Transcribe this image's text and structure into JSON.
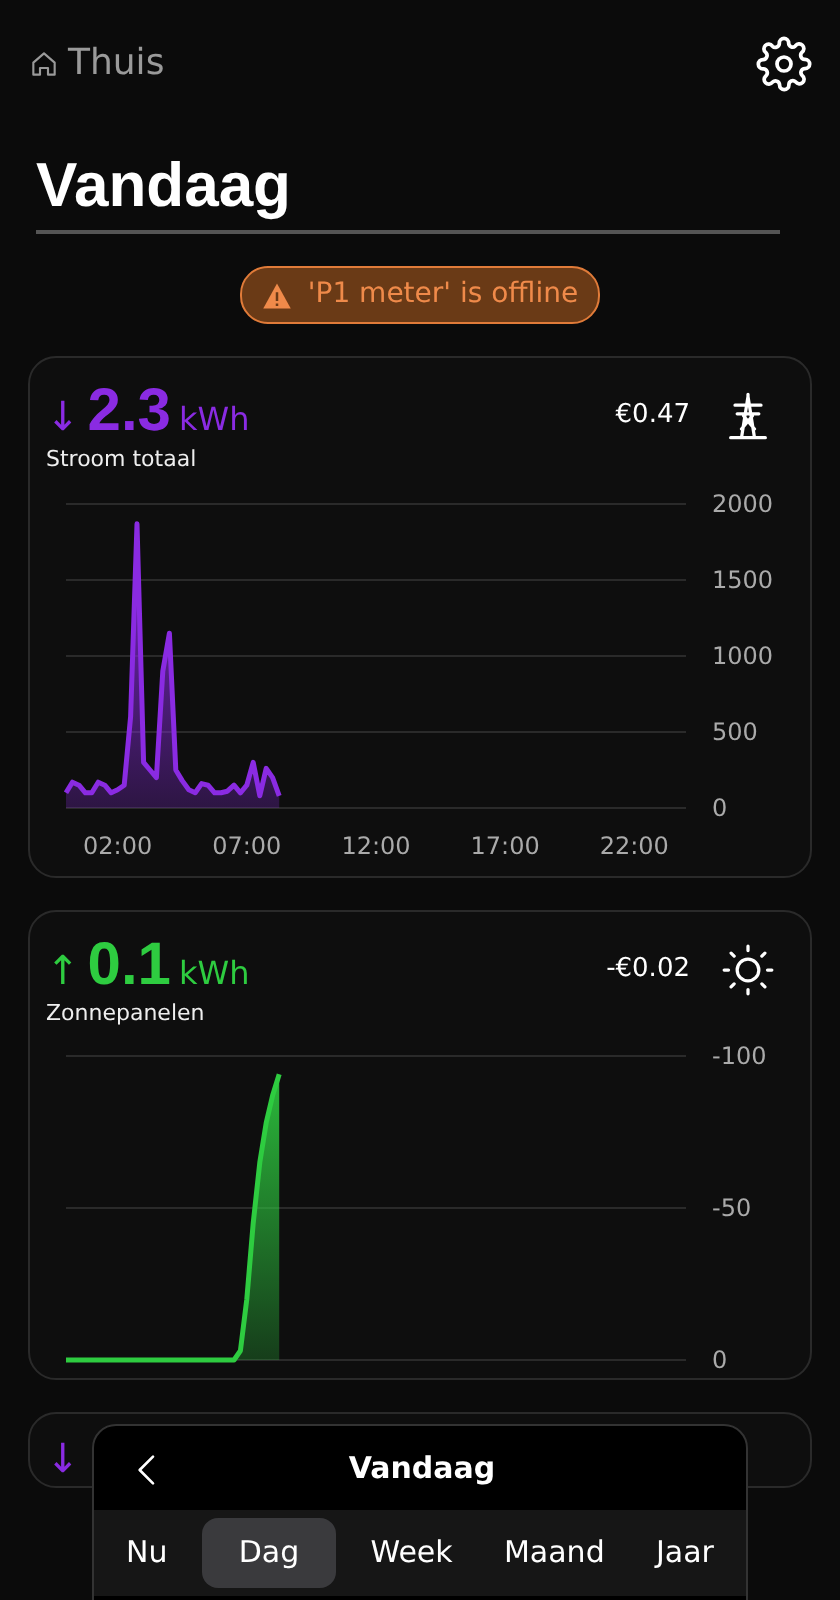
{
  "header": {
    "back_label": "Thuis"
  },
  "title": "Vandaag",
  "alert": {
    "text": "'P1 meter' is offline"
  },
  "cards": [
    {
      "kind": "grid",
      "arrow": "↓",
      "value": "2.3",
      "unit": "kWh",
      "label": "Stroom totaal",
      "cost": "€0.47",
      "color": "#8a2be2",
      "chart_data": {
        "type": "area",
        "x": [
          0,
          0.25,
          0.5,
          0.75,
          1,
          1.25,
          1.5,
          1.75,
          2,
          2.25,
          2.5,
          2.75,
          3,
          3.25,
          3.5,
          3.75,
          4,
          4.25,
          4.5,
          4.75,
          5,
          5.25,
          5.5,
          5.75,
          6,
          6.25,
          6.5,
          6.75,
          7,
          7.25,
          7.5,
          7.75,
          8,
          8.25
        ],
        "grid": true,
        "series": [
          {
            "color": "#8a2be2",
            "values": [
              100,
              170,
              150,
              100,
              100,
              170,
              150,
              100,
              120,
              150,
              600,
              1870,
              300,
              250,
              200,
              900,
              1150,
              250,
              180,
              120,
              100,
              160,
              150,
              100,
              100,
              110,
              150,
              100,
              150,
              300,
              80,
              260,
              200,
              80
            ]
          }
        ],
        "xlim": [
          0,
          24
        ],
        "ylim": [
          0,
          2000
        ],
        "yticks": [
          0,
          500,
          1000,
          1500,
          2000
        ],
        "xticks": [
          {
            "value": 2,
            "label": "02:00"
          },
          {
            "value": 7,
            "label": "07:00"
          },
          {
            "value": 12,
            "label": "12:00"
          },
          {
            "value": 17,
            "label": "17:00"
          },
          {
            "value": 22,
            "label": "22:00"
          }
        ]
      }
    },
    {
      "kind": "solar",
      "arrow": "↑",
      "value": "0.1",
      "unit": "kWh",
      "label": "Zonnepanelen",
      "cost": "-€0.02",
      "color": "#2ecc40",
      "chart_data": {
        "type": "area",
        "x": [
          0,
          1,
          2,
          3,
          4,
          5,
          6,
          6.5,
          6.75,
          7,
          7.25,
          7.5,
          7.75,
          8,
          8.25
        ],
        "grid": true,
        "series": [
          {
            "color": "#2ecc40",
            "values": [
              0,
              0,
              0,
              0,
              0,
              0,
              0,
              0,
              -3,
              -20,
              -45,
              -65,
              -78,
              -87,
              -94
            ]
          }
        ],
        "xlim": [
          0,
          24
        ],
        "ylim": [
          0,
          -100
        ],
        "yticks": [
          0,
          {
            "value": -50,
            "label": "-50"
          },
          {
            "value": -100,
            "label": "-100"
          }
        ]
      }
    },
    {
      "kind": "partial",
      "arrow": "↓",
      "color": "#8a2be2"
    }
  ],
  "period": {
    "title": "Vandaag",
    "tabs": [
      {
        "label": "Nu",
        "selected": false
      },
      {
        "label": "Dag",
        "selected": true
      },
      {
        "label": "Week",
        "selected": false
      },
      {
        "label": "Maand",
        "selected": false
      },
      {
        "label": "Jaar",
        "selected": false
      }
    ]
  }
}
